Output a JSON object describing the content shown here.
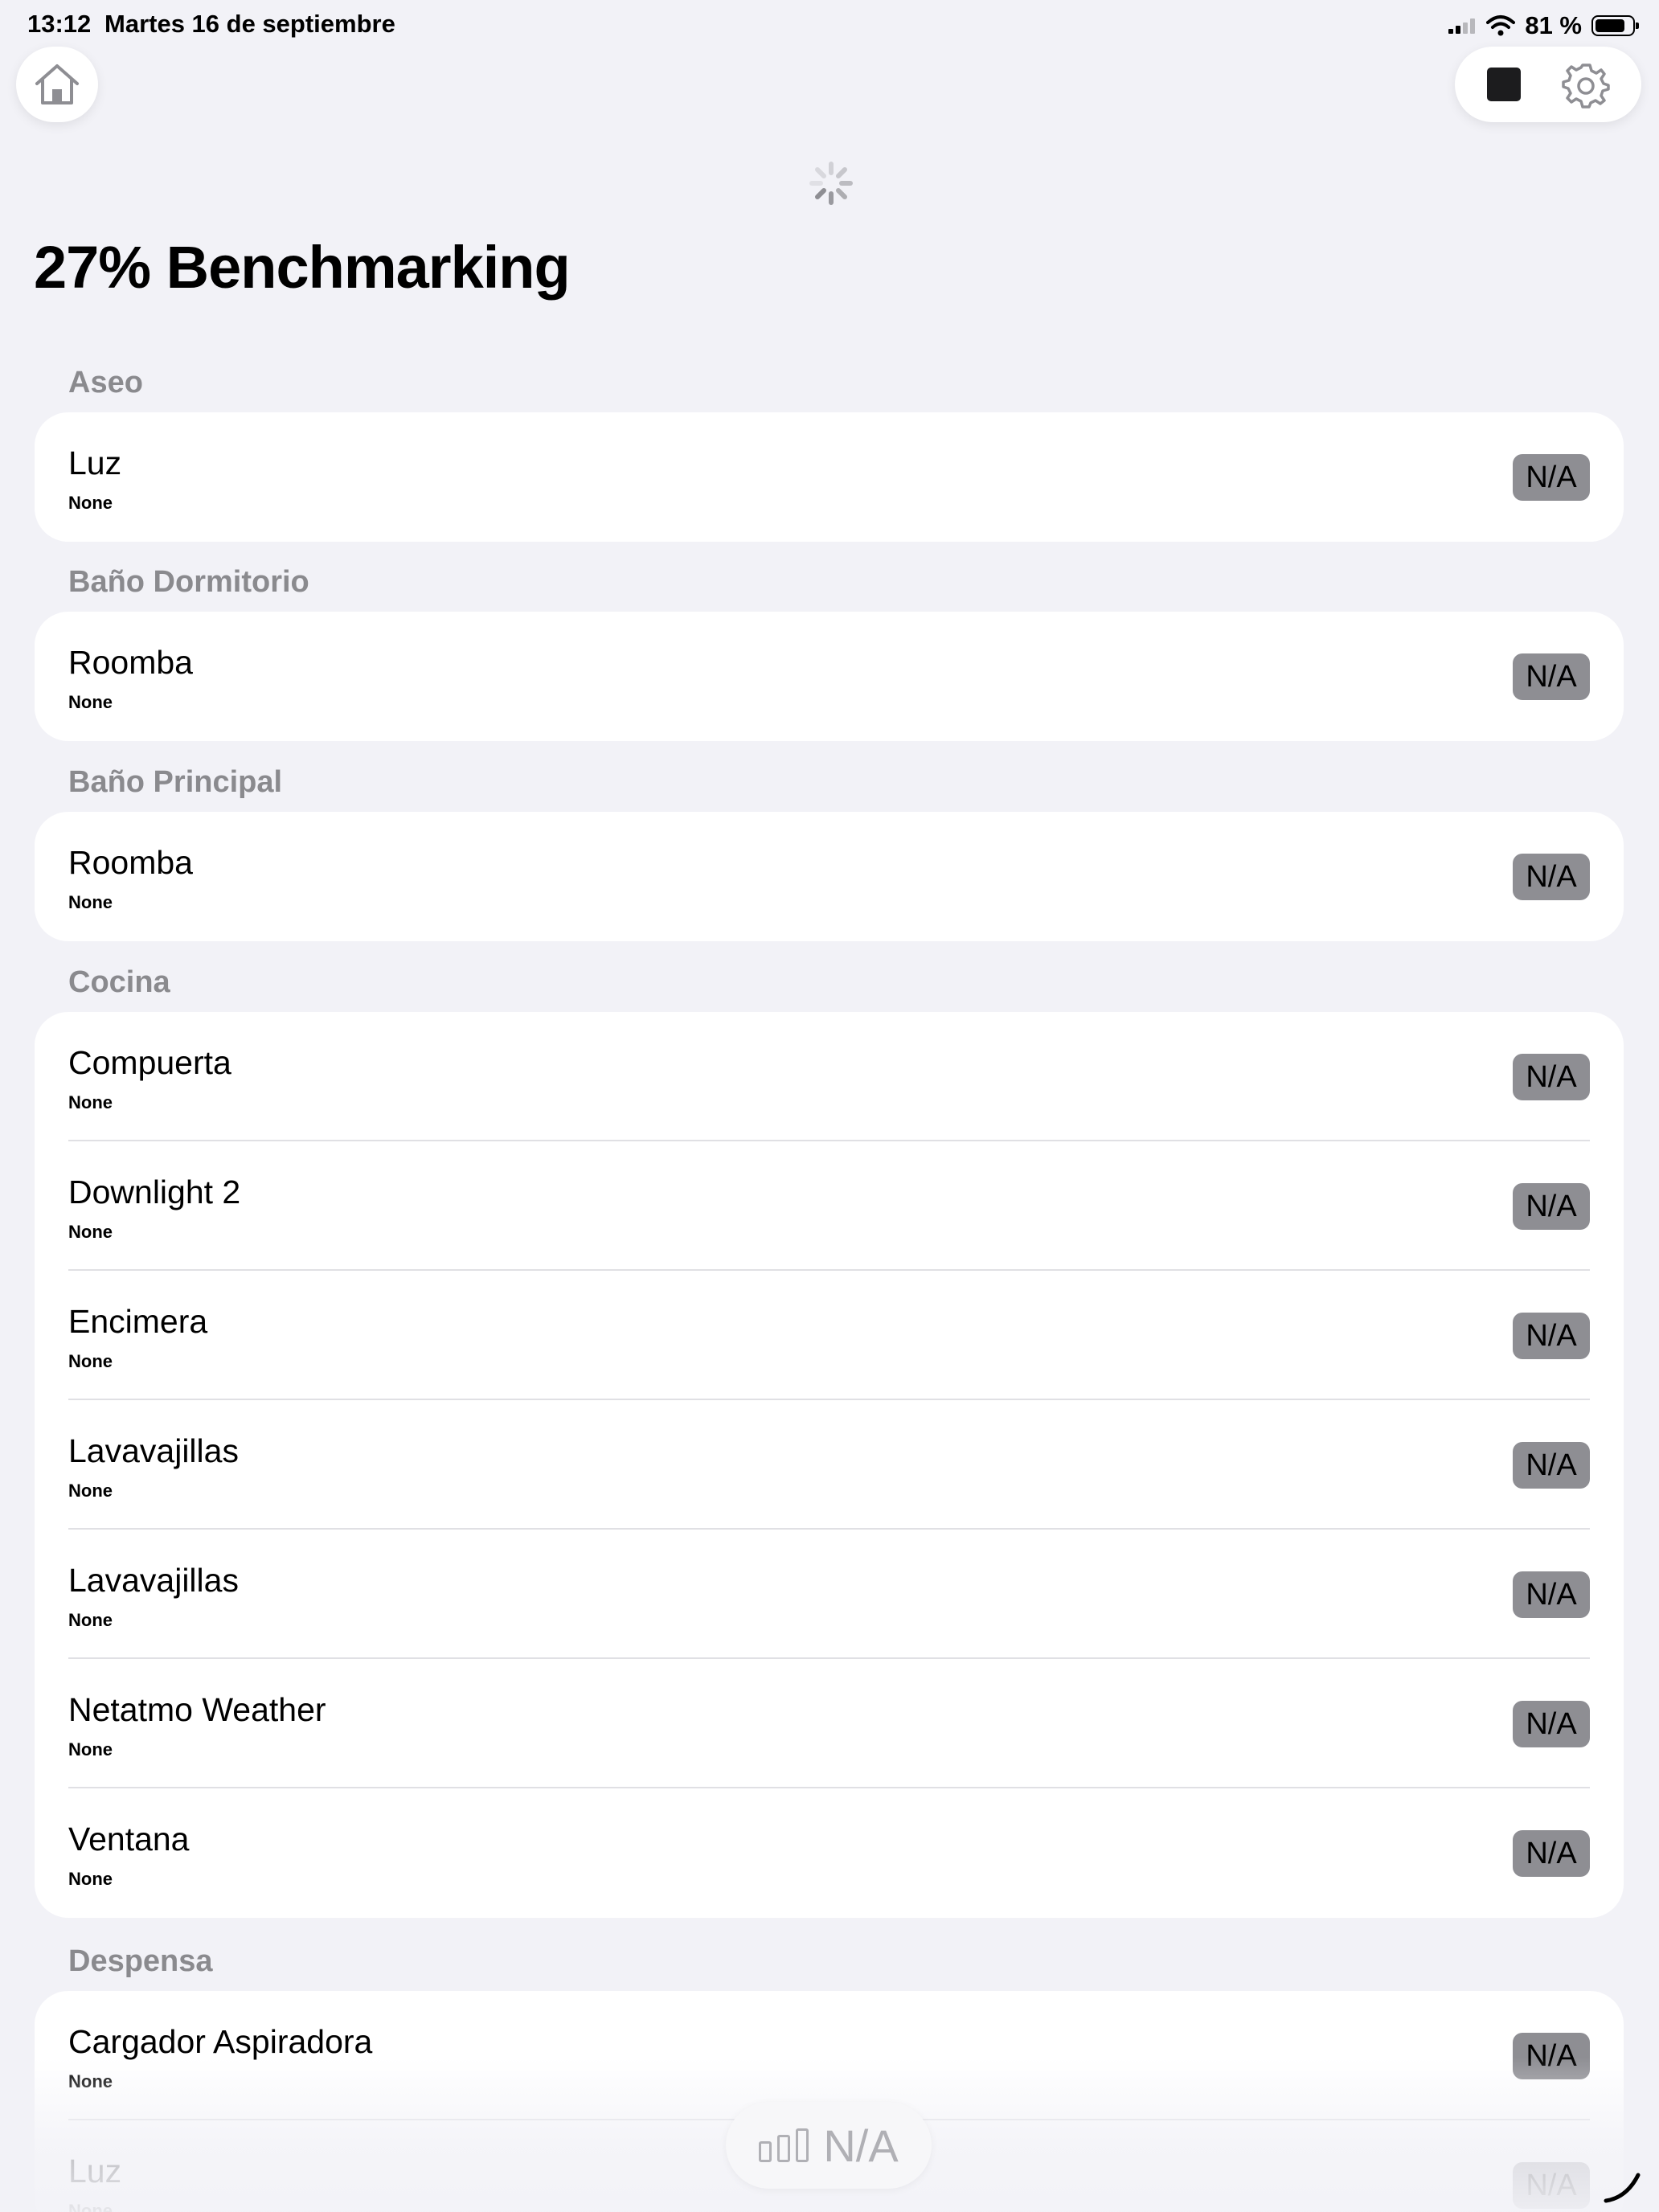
{
  "status_bar": {
    "time": "13:12",
    "date": "Martes 16 de septiembre",
    "battery_percent": "81 %",
    "battery_level": 0.81
  },
  "page_title": "27% Benchmarking",
  "sections": [
    {
      "title": "Aseo",
      "items": [
        {
          "name": "Luz",
          "subtitle": "None",
          "value": "N/A"
        }
      ]
    },
    {
      "title": "Baño Dormitorio",
      "items": [
        {
          "name": "Roomba",
          "subtitle": "None",
          "value": "N/A"
        }
      ]
    },
    {
      "title": "Baño Principal",
      "items": [
        {
          "name": "Roomba",
          "subtitle": "None",
          "value": "N/A"
        }
      ]
    },
    {
      "title": "Cocina",
      "items": [
        {
          "name": "Compuerta",
          "subtitle": "None",
          "value": "N/A"
        },
        {
          "name": "Downlight 2",
          "subtitle": "None",
          "value": "N/A"
        },
        {
          "name": "Encimera",
          "subtitle": "None",
          "value": "N/A"
        },
        {
          "name": "Lavavajillas",
          "subtitle": "None",
          "value": "N/A"
        },
        {
          "name": "Lavavajillas",
          "subtitle": "None",
          "value": "N/A"
        },
        {
          "name": "Netatmo Weather",
          "subtitle": "None",
          "value": "N/A"
        },
        {
          "name": "Ventana",
          "subtitle": "None",
          "value": "N/A"
        }
      ]
    },
    {
      "title": "Despensa",
      "items": [
        {
          "name": "Cargador Aspiradora",
          "subtitle": "None",
          "value": "N/A"
        },
        {
          "name": "Luz",
          "subtitle": "None",
          "value": "N/A"
        }
      ]
    }
  ],
  "summary": {
    "label": "N/A"
  },
  "icons": {
    "home": "home-icon",
    "stop": "stop-icon",
    "settings": "gear-icon",
    "loading": "spinner-icon",
    "summary": "bar-chart-icon",
    "wifi": "wifi-icon",
    "signal": "signal-icon",
    "battery": "battery-icon"
  },
  "colors": {
    "background": "#f2f2f7",
    "card": "#ffffff",
    "badge": "#8e8e93",
    "section_header": "#8a8a8e"
  }
}
